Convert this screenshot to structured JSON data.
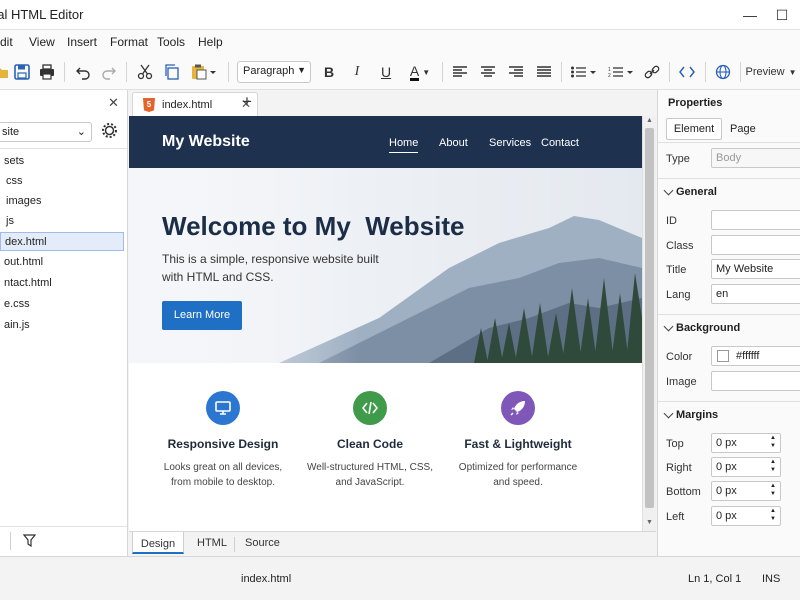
{
  "window": {
    "title": "ual HTML Editor",
    "minimize": "—",
    "maximize": "☐",
    "close": "✕"
  },
  "menu": [
    "dit",
    "View",
    "Insert",
    "Format",
    "Tools",
    "Help"
  ],
  "toolbar": {
    "paragraph": "Paragraph",
    "preview": "Preview",
    "bold": "B",
    "italic": "I",
    "underline": "U",
    "font_color": "A"
  },
  "left_panel": {
    "site": "site",
    "tree": [
      "sets",
      "css",
      "images",
      "js",
      "dex.html",
      "out.html",
      "ntact.html",
      "e.css",
      "ain.js"
    ],
    "selected_index": 4
  },
  "editor": {
    "tab_label": "index.html",
    "new_tab": "+"
  },
  "website": {
    "brand": "My Website",
    "nav": [
      "Home",
      "About",
      "Services",
      "Contact"
    ],
    "hero_title": "Welcome to My  Website",
    "hero_text_1": "This is a simple, responsive website built",
    "hero_text_2": "with HTML and CSS.",
    "cta": "Learn More",
    "features": [
      {
        "title": "Responsive Design",
        "line1": "Looks great on all devices,",
        "line2": "from mobile to desktop.",
        "color": "#2b76d0",
        "icon": "monitor-icon"
      },
      {
        "title": "Clean Code",
        "line1": "Well-structured HTML, CSS,",
        "line2": "and JavaScript.",
        "color": "#3f9a4a",
        "icon": "code-icon"
      },
      {
        "title": "Fast & Lightweight",
        "line1": "Optimized for performance",
        "line2": "and speed.",
        "color": "#7e57b8",
        "icon": "rocket-icon"
      }
    ]
  },
  "bottom_tabs": [
    "Design",
    "HTML",
    "Source"
  ],
  "properties": {
    "title": "Properties",
    "tabs": [
      "Element",
      "Page"
    ],
    "type_label": "Type",
    "type_value": "Body",
    "general": "General",
    "id_label": "ID",
    "id_value": "",
    "class_label": "Class",
    "class_value": "",
    "title_label": "Title",
    "title_value": "My Website",
    "lang_label": "Lang",
    "lang_value": "en",
    "background": "Background",
    "color_label": "Color",
    "color_value": "#ffffff",
    "image_label": "Image",
    "image_value": "",
    "margins": "Margins",
    "top_label": "Top",
    "top_value": "0 px",
    "right_label": "Right",
    "right_value": "0 px",
    "bottom_label": "Bottom",
    "bottom_value": "0 px",
    "left_label": "Left",
    "left_value": "0 px"
  },
  "status": {
    "file": "index.html",
    "position": "Ln 1, Col 1",
    "mode": "INS"
  },
  "colors": {
    "header": "#1e3250",
    "accent": "#1f6fc5"
  }
}
